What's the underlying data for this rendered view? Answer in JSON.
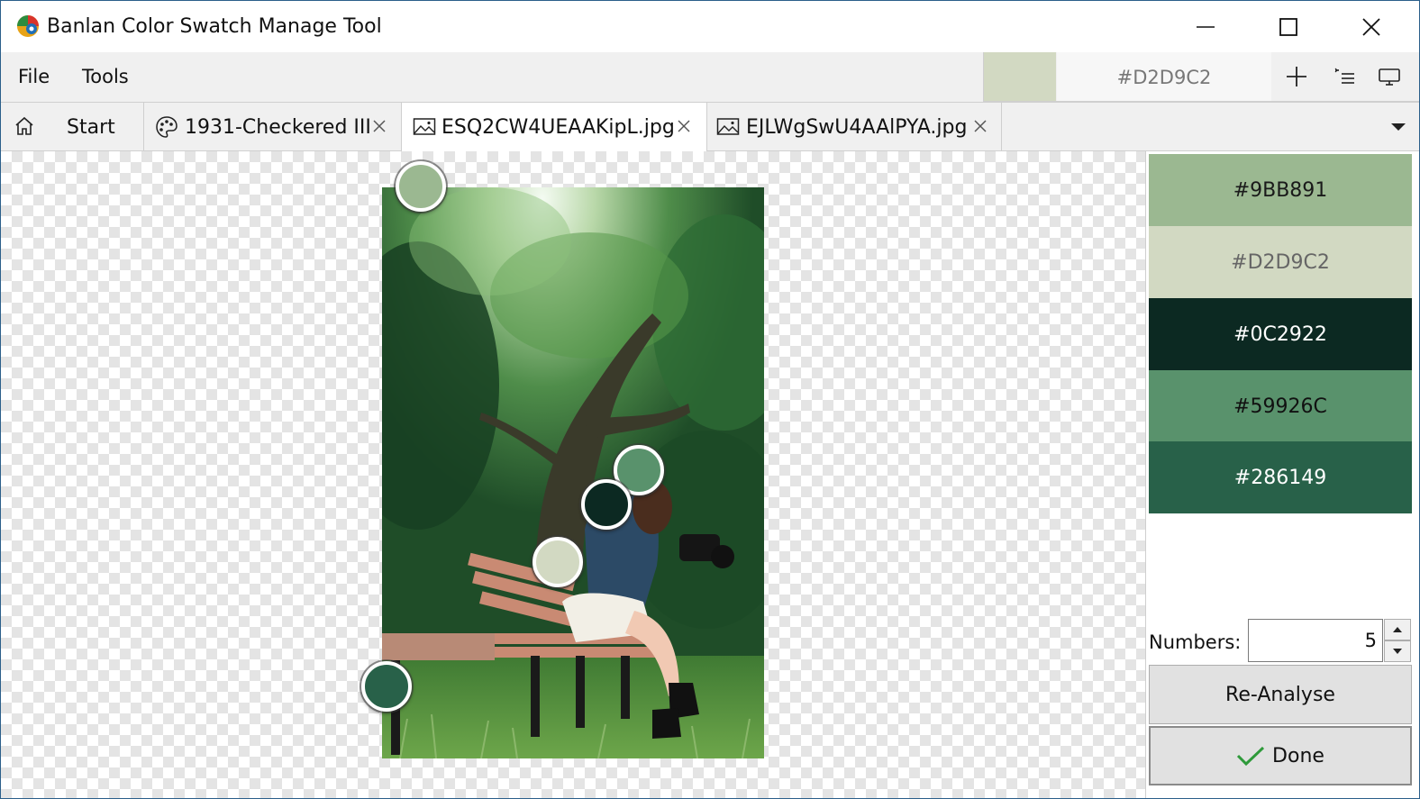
{
  "app": {
    "title": "Banlan Color Swatch Manage Tool",
    "logo_icon": "banlan-logo-icon"
  },
  "window_controls": {
    "minimize_icon": "minimize-icon",
    "maximize_icon": "maximize-icon",
    "close_icon": "close-icon"
  },
  "menu": {
    "items": [
      {
        "label": "File"
      },
      {
        "label": "Tools"
      }
    ]
  },
  "current_color": {
    "hex": "#D2D9C2",
    "swatch_color": "#D2D9C2"
  },
  "toolbar": {
    "icons": [
      "add-icon",
      "list-icon",
      "screen-icon"
    ]
  },
  "tabs": [
    {
      "label": "Start",
      "icon": "home-icon",
      "closable": false,
      "active": false
    },
    {
      "label": "1931-Checkered III",
      "icon": "palette-icon",
      "closable": true,
      "active": false
    },
    {
      "label": "ESQ2CW4UEAAKipL.jpg",
      "icon": "image-icon",
      "closable": true,
      "active": true
    },
    {
      "label": "EJLWgSwU4AAlPYA.jpg",
      "icon": "image-icon",
      "closable": true,
      "active": false
    }
  ],
  "swatches": [
    {
      "hex": "#9BB891",
      "color": "#9BB891",
      "text_color": "#1a1a1a"
    },
    {
      "hex": "#D2D9C2",
      "color": "#D2D9C2",
      "text_color": "#666666"
    },
    {
      "hex": "#0C2922",
      "color": "#0C2922",
      "text_color": "#ffffff"
    },
    {
      "hex": "#59926C",
      "color": "#59926C",
      "text_color": "#111111"
    },
    {
      "hex": "#286149",
      "color": "#286149",
      "text_color": "#ffffff"
    }
  ],
  "analysis": {
    "numbers_label": "Numbers:",
    "numbers_value": "5",
    "reanalyse_label": "Re-Analyse",
    "done_label": "Done",
    "done_icon": "checkmark-icon"
  }
}
